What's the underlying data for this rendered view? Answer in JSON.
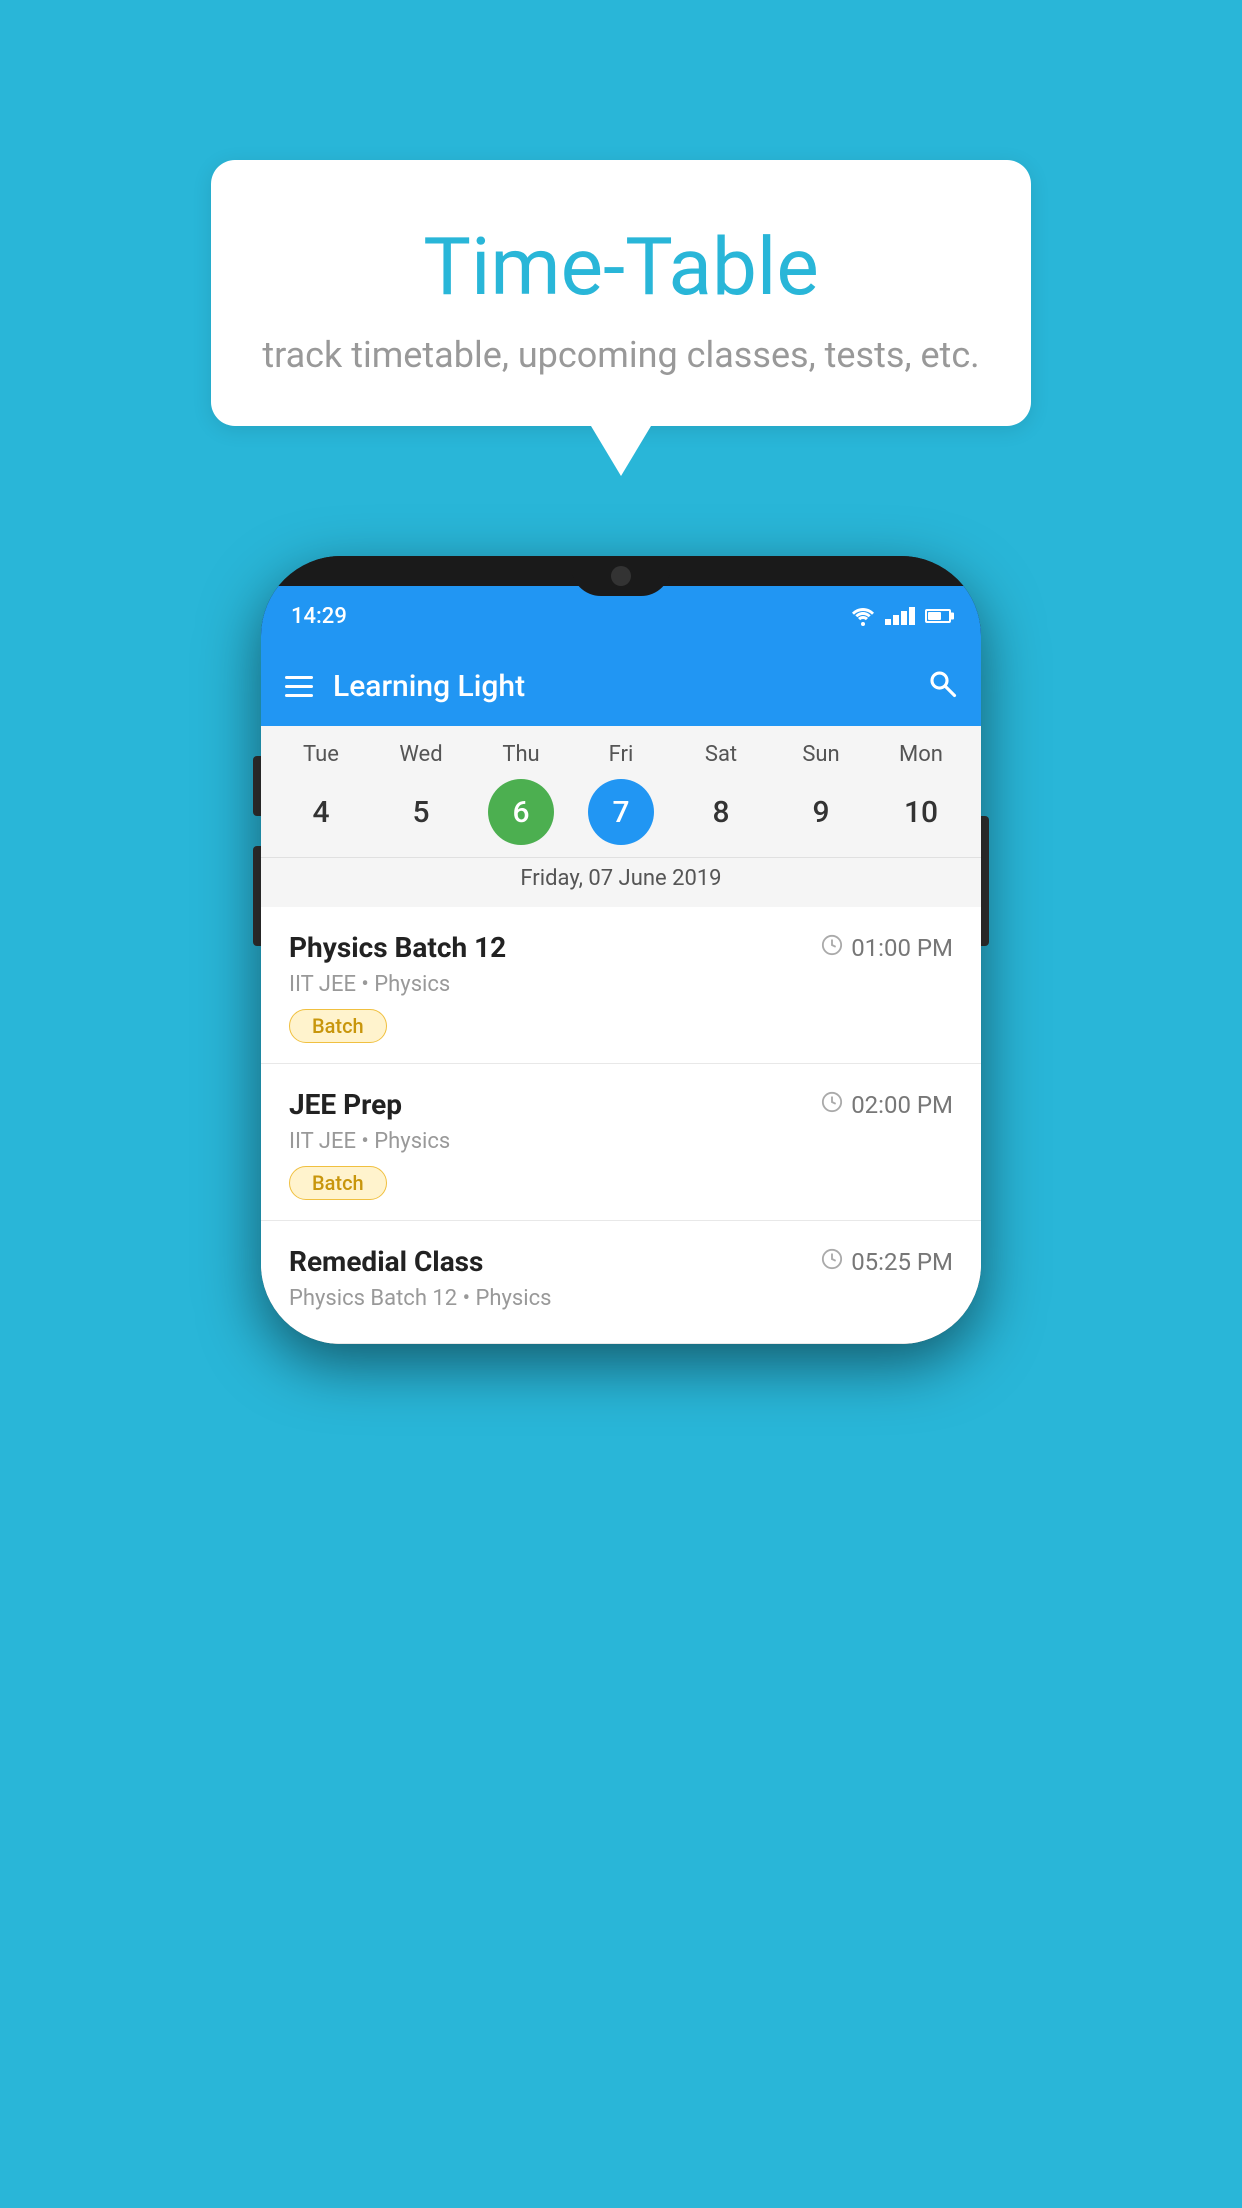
{
  "background_color": "#29b6d8",
  "speech_bubble": {
    "title": "Time-Table",
    "subtitle": "track timetable, upcoming classes, tests, etc."
  },
  "app": {
    "title": "Learning Light",
    "status_time": "14:29"
  },
  "calendar": {
    "days": [
      "Tue",
      "Wed",
      "Thu",
      "Fri",
      "Sat",
      "Sun",
      "Mon"
    ],
    "dates": [
      4,
      5,
      6,
      7,
      8,
      9,
      10
    ],
    "today_index": 2,
    "selected_index": 3,
    "selected_date_label": "Friday, 07 June 2019"
  },
  "schedule": [
    {
      "title": "Physics Batch 12",
      "time": "01:00 PM",
      "subtitle": "IIT JEE • Physics",
      "badge": "Batch"
    },
    {
      "title": "JEE Prep",
      "time": "02:00 PM",
      "subtitle": "IIT JEE • Physics",
      "badge": "Batch"
    },
    {
      "title": "Remedial Class",
      "time": "05:25 PM",
      "subtitle": "Physics Batch 12 • Physics",
      "badge": ""
    }
  ],
  "labels": {
    "hamburger": "☰",
    "search": "🔍",
    "clock": "🕐",
    "batch_badge": "Batch"
  }
}
